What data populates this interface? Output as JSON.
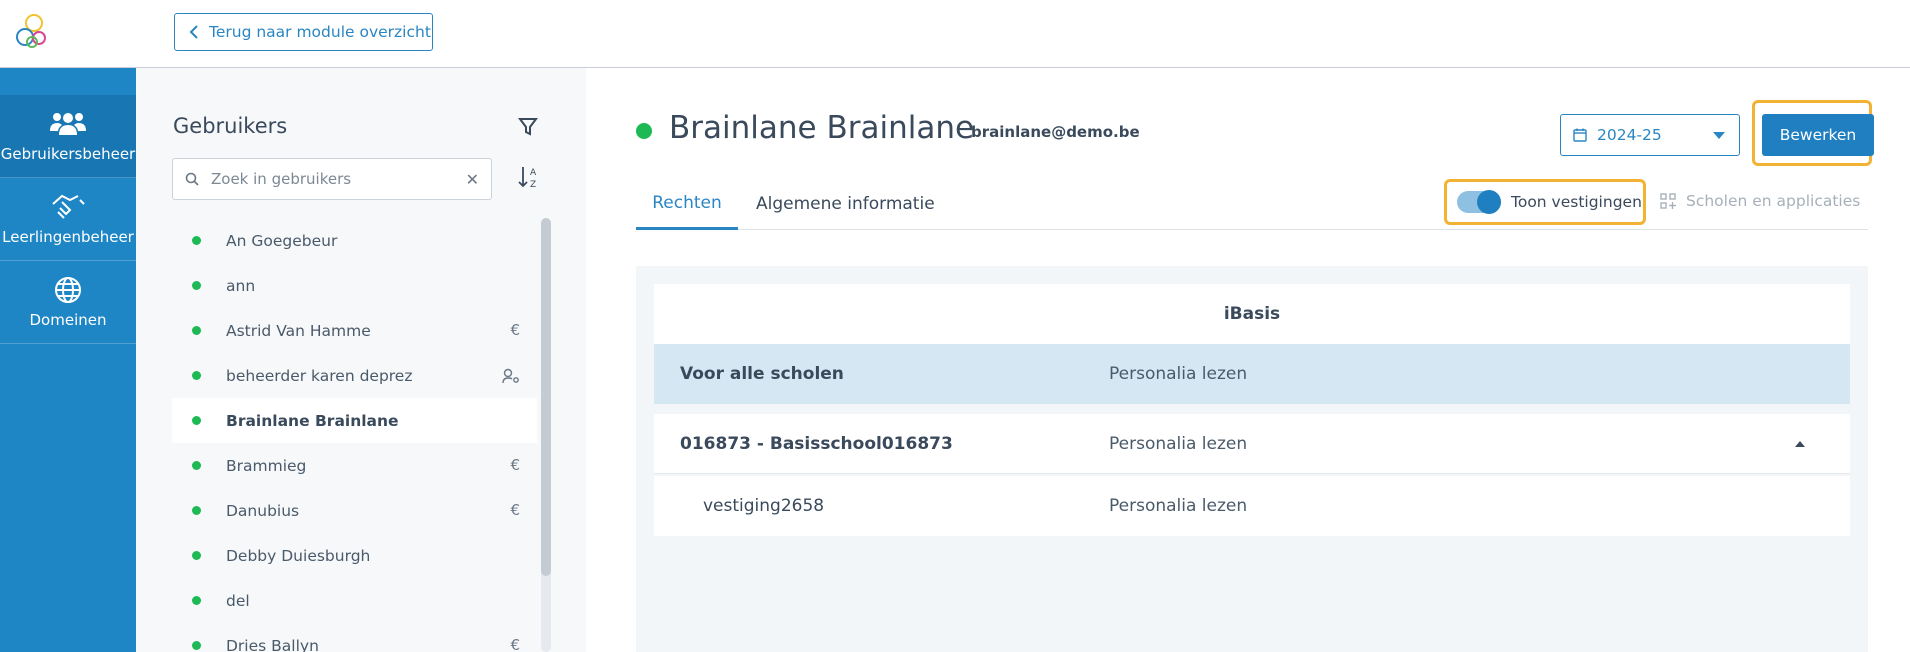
{
  "topbar": {
    "back_label": "Terug naar module overzicht"
  },
  "nav": {
    "items": [
      {
        "label": "Gebruikersbeheer",
        "icon": "users-icon",
        "active": true
      },
      {
        "label": "Leerlingenbeheer",
        "icon": "handshake-icon",
        "active": false
      },
      {
        "label": "Domeinen",
        "icon": "globe-icon",
        "active": false
      }
    ]
  },
  "user_panel": {
    "title": "Gebruikers",
    "search_placeholder": "Zoek in gebruikers",
    "users": [
      {
        "name": "An Goegebeur",
        "trail": ""
      },
      {
        "name": "ann",
        "trail": ""
      },
      {
        "name": "Astrid Van Hamme",
        "trail": "€"
      },
      {
        "name": "beheerder karen deprez",
        "trail": "user-gear-icon"
      },
      {
        "name": "Brainlane Brainlane",
        "trail": "",
        "selected": true
      },
      {
        "name": "Brammieg",
        "trail": "€"
      },
      {
        "name": "Danubius",
        "trail": "€"
      },
      {
        "name": "Debby Duiesburgh",
        "trail": ""
      },
      {
        "name": "del",
        "trail": ""
      },
      {
        "name": "Dries Ballyn",
        "trail": "€"
      }
    ]
  },
  "main": {
    "user_name": "Brainlane Brainlane",
    "user_email": "brainlane@demo.be",
    "year": "2024-25",
    "edit_label": "Bewerken",
    "tabs": [
      {
        "label": "Rechten",
        "active": true
      },
      {
        "label": "Algemene informatie",
        "active": false
      }
    ],
    "toggle_label": "Toon vestigingen",
    "schools_label": "Scholen en applicaties",
    "card": {
      "header": "iBasis",
      "rows": [
        {
          "name": "Voor alle scholen",
          "right": "Personalia lezen"
        },
        {
          "name": "016873 - Basisschool016873",
          "right": "Personalia lezen"
        },
        {
          "name": "vestiging2658",
          "right": "Personalia lezen"
        }
      ]
    }
  },
  "colors": {
    "primary": "#1f86c6",
    "highlight": "#f2b233",
    "status_green": "#1db954",
    "selected_row": "#d5e7f3"
  }
}
